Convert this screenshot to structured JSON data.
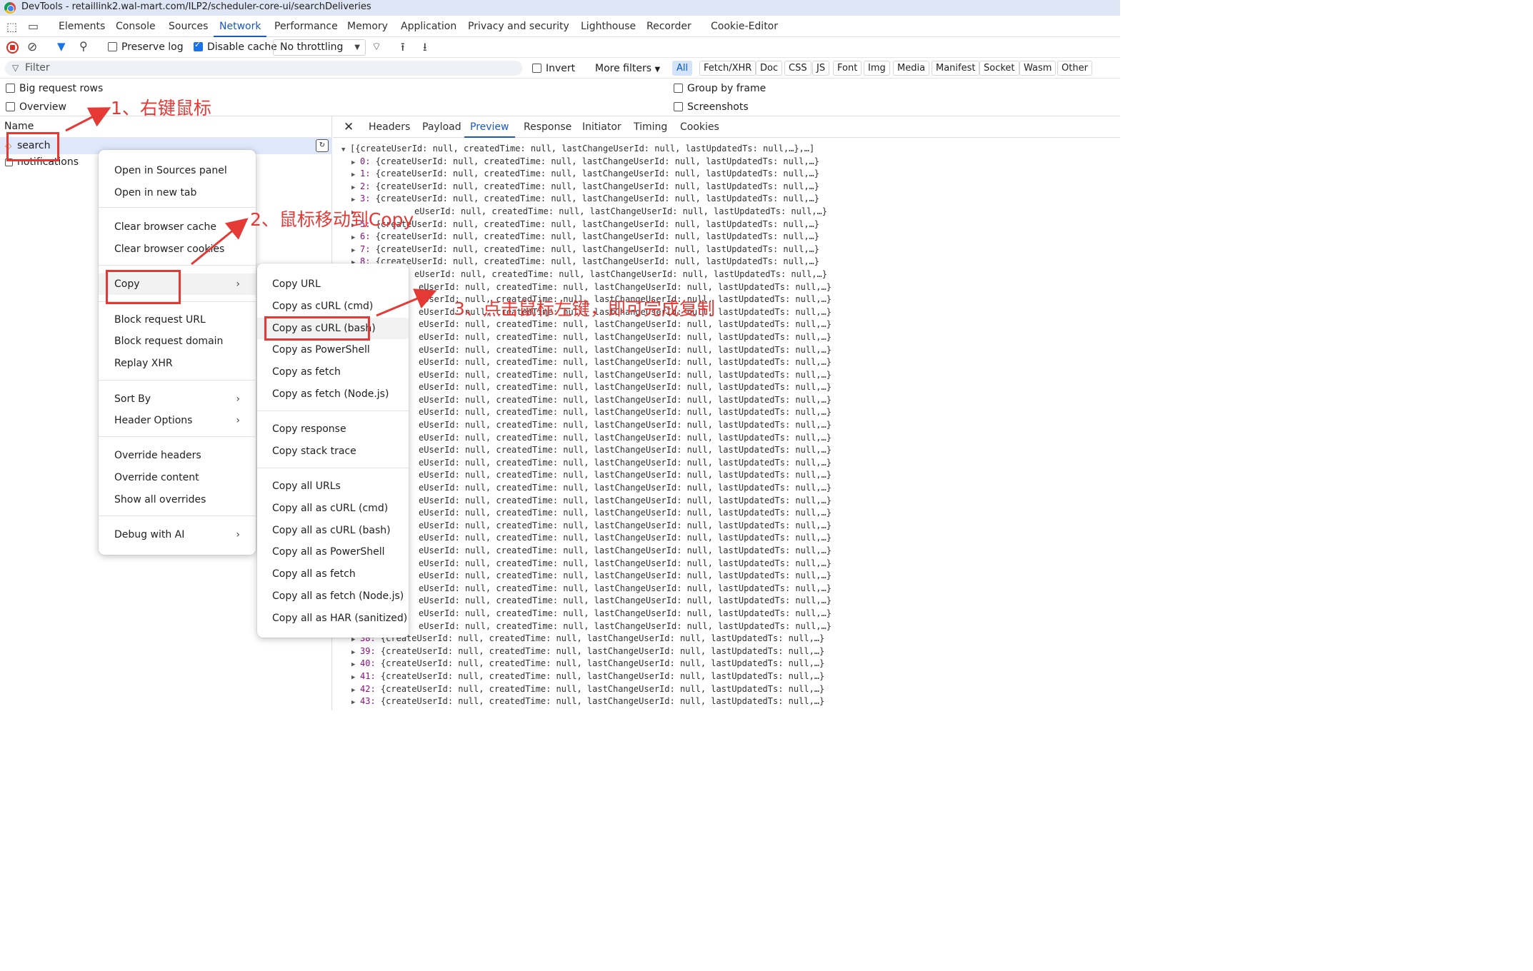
{
  "window": {
    "title": "DevTools - retaillink2.wal-mart.com/ILP2/scheduler-core-ui/searchDeliveries"
  },
  "panel_tabs": [
    "Elements",
    "Console",
    "Sources",
    "Network",
    "Performance",
    "Memory",
    "Application",
    "Privacy and security",
    "Lighthouse",
    "Recorder",
    "Cookie-Editor"
  ],
  "active_panel": "Network",
  "toolbar": {
    "preserve_log": "Preserve log",
    "disable_cache": "Disable cache",
    "throttling": "No throttling"
  },
  "filter": {
    "placeholder": "Filter",
    "invert": "Invert",
    "more_filters": "More filters"
  },
  "type_chips": [
    "All",
    "Fetch/XHR",
    "Doc",
    "CSS",
    "JS",
    "Font",
    "Img",
    "Media",
    "Manifest",
    "Socket",
    "Wasm",
    "Other"
  ],
  "options": {
    "big_rows": "Big request rows",
    "overview": "Overview",
    "group_by_frame": "Group by frame",
    "screenshots": "Screenshots"
  },
  "requests": {
    "header": "Name",
    "rows": [
      "search",
      "notifications"
    ]
  },
  "detail_tabs": [
    "Headers",
    "Payload",
    "Preview",
    "Response",
    "Initiator",
    "Timing",
    "Cookies"
  ],
  "active_detail_tab": "Preview",
  "preview": {
    "root": "[{createUserId: null, createdTime: null, lastChangeUserId: null, lastUpdatedTs: null,…},…]",
    "item_text": "{createUserId: null, createdTime: null, lastChangeUserId: null, lastUpdatedTs: null,…}",
    "partial_text": "eUserId: null, createdTime: null, lastChangeUserId: null, lastUpdatedTs: null,…}",
    "visible_indices": [
      "0:",
      "1:",
      "2:",
      "3:",
      "5:",
      "6:",
      "7:",
      "8:",
      "38:",
      "39:",
      "40:",
      "41:",
      "42:",
      "43:"
    ]
  },
  "context_menu": {
    "items": [
      "Open in Sources panel",
      "Open in new tab",
      "Clear browser cache",
      "Clear browser cookies",
      "Copy",
      "Block request URL",
      "Block request domain",
      "Replay XHR",
      "Sort By",
      "Header Options",
      "Override headers",
      "Override content",
      "Show all overrides",
      "Debug with AI"
    ]
  },
  "copy_submenu": {
    "items": [
      "Copy URL",
      "Copy as cURL (cmd)",
      "Copy as cURL (bash)",
      "Copy as PowerShell",
      "Copy as fetch",
      "Copy as fetch (Node.js)",
      "Copy response",
      "Copy stack trace",
      "Copy all URLs",
      "Copy all as cURL (cmd)",
      "Copy all as cURL (bash)",
      "Copy all as PowerShell",
      "Copy all as fetch",
      "Copy all as fetch (Node.js)",
      "Copy all as HAR (sanitized)"
    ]
  },
  "annotations": {
    "step1": "1、右键鼠标",
    "step2": "2、鼠标移动到Copy",
    "step3": "3、点击鼠标左键，即可完成复制"
  },
  "colors": {
    "accent": "#1a57c9",
    "annotation": "#e53935",
    "selected_row": "#dfe7fb"
  }
}
